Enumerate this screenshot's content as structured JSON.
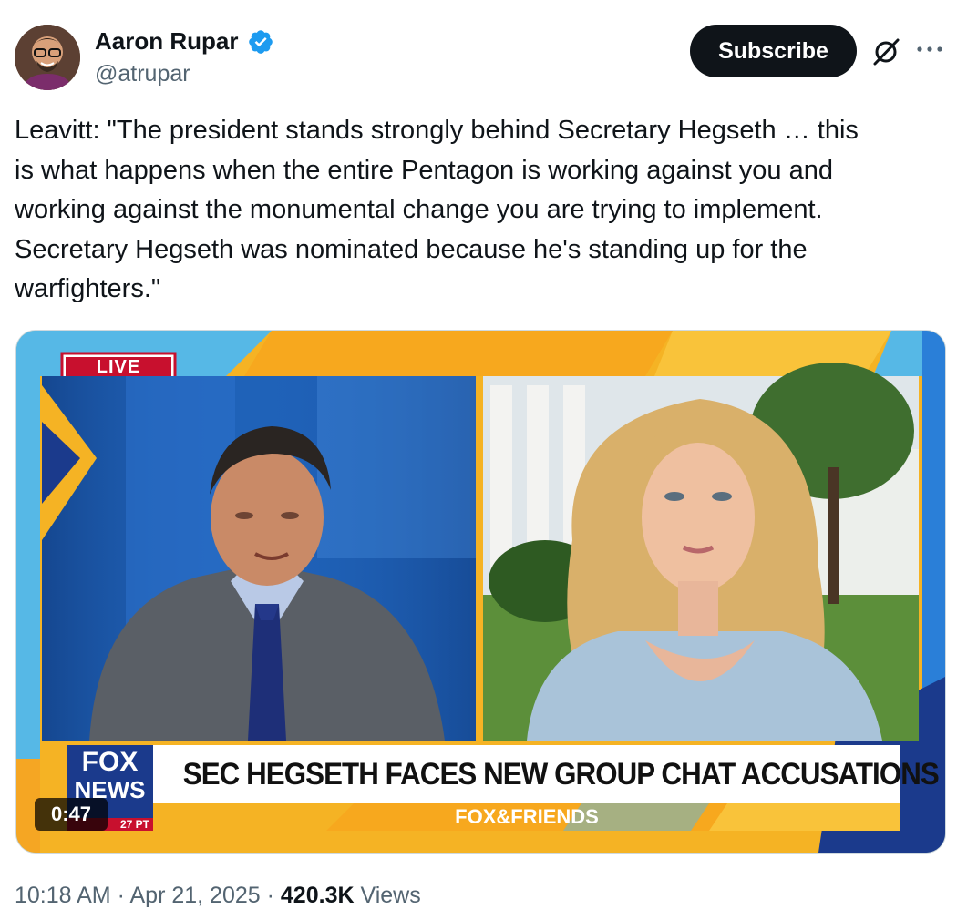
{
  "author": {
    "name": "Aaron Rupar",
    "handle": "@atrupar",
    "verified": true
  },
  "actions": {
    "subscribe_label": "Subscribe"
  },
  "icons": [
    "verified-badge-icon",
    "grok-icon",
    "more-icon"
  ],
  "tweet": {
    "text": "Leavitt: \"The president stands strongly behind Secretary Hegseth … this\nis what happens when the entire Pentagon is working against you and\nworking against the monumental change you are trying to implement.\nSecretary Hegseth was nominated because he's standing up for the\nwarfighters.\""
  },
  "video": {
    "live_label": "LIVE",
    "chyron": "SEC HEGSETH FACES NEW GROUP CHAT ACCUSATIONS",
    "network_top": "FOX",
    "network_bottom": "NEWS",
    "clock_fragment": "27 PT",
    "show_name": "FOX&FRIENDS",
    "duration": "0:47"
  },
  "meta": {
    "time": "10:18 AM",
    "separator": "·",
    "date": "Apr 21, 2025",
    "views_count": "420.3K",
    "views_label": "Views"
  },
  "colors": {
    "accent_blue": "#1d9bf0",
    "text_primary": "#0f1419",
    "text_secondary": "#536471",
    "fox_red": "#c8102e",
    "fox_orange": "#f5a623",
    "fox_blue": "#1b3a8c"
  }
}
